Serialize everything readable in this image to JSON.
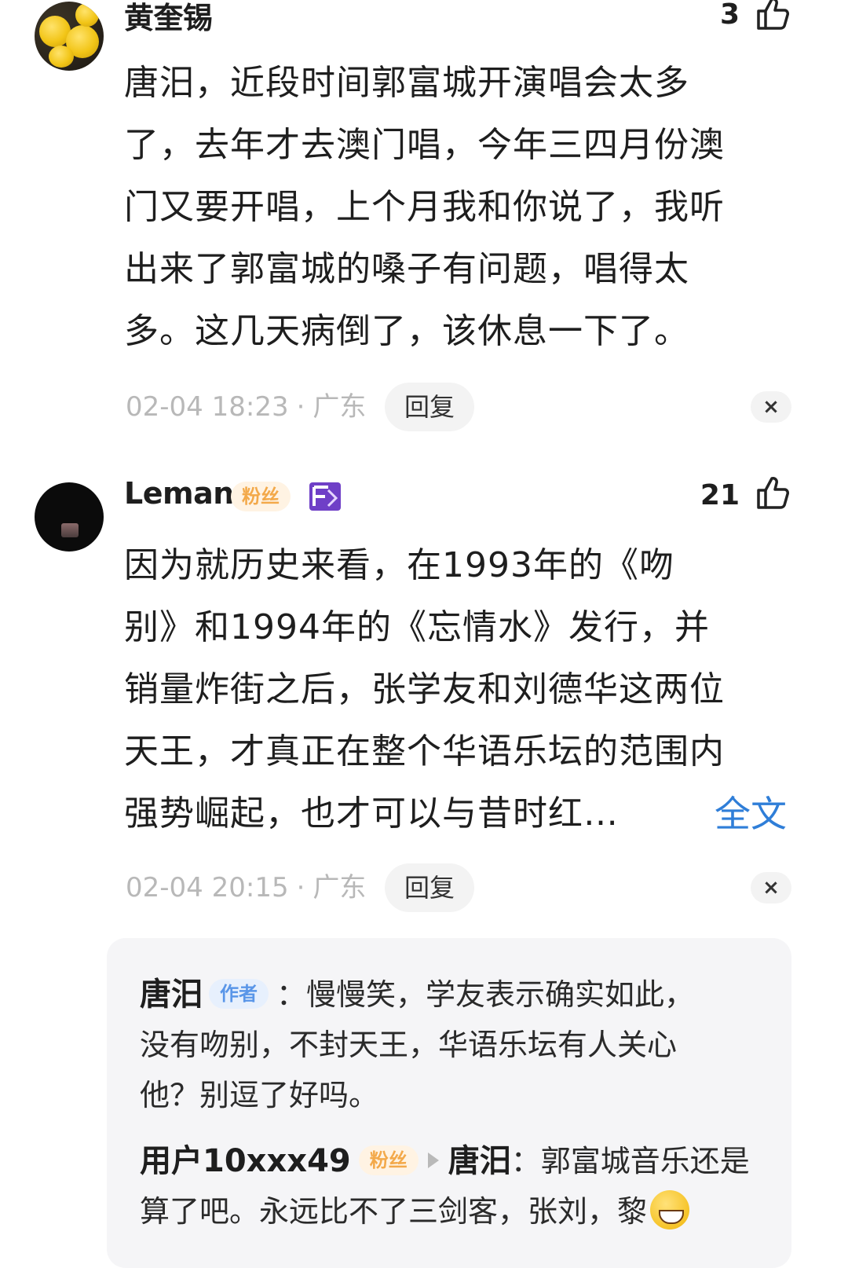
{
  "comments": [
    {
      "username": "黄奎锡",
      "like_count": "3",
      "lines": [
        "唐汨，近段时间郭富城开演唱会太多",
        "了，去年才去澳门唱，今年三四月份澳",
        "门又要开唱，上个月我和你说了，我听",
        "出来了郭富城的嗓子有问题，唱得太",
        "多。这几天病倒了，该休息一下了。"
      ],
      "timestamp": "02-04 18:23",
      "location": "广东",
      "reply_label": "回复",
      "close_label": "×"
    },
    {
      "username": "Leman",
      "fan_badge": "粉丝",
      "like_count": "21",
      "lines": [
        "因为就历史来看，在1993年的《吻",
        "别》和1994年的《忘情水》发行，并",
        "销量炸街之后，张学友和刘德华这两位",
        "天王，才真正在整个华语乐坛的范围内",
        "强势崛起，也才可以与昔时红…"
      ],
      "full_text_label": "全文",
      "timestamp": "02-04 20:15",
      "location": "广东",
      "reply_label": "回复",
      "close_label": "×"
    }
  ],
  "replies": [
    {
      "author": "唐汨",
      "author_badge": "作者",
      "separator": "：",
      "lines": [
        "慢慢笑，学友表示确实如此，",
        "没有吻别，不封天王，华语乐坛有人关心",
        "他？别逗了好吗。"
      ]
    },
    {
      "author": "用户10xxx49",
      "author_badge": "粉丝",
      "reply_to": "唐汨",
      "separator": "：",
      "lines": [
        "郭富城音乐还是",
        "算了吧。永远比不了三剑客，张刘，黎"
      ],
      "emoji": "grinning-face"
    }
  ],
  "colors": {
    "link": "#2f7ed8",
    "fan_badge_text": "#f3a94a",
    "author_badge_text": "#5a96e8",
    "meta_text": "#b8b8b8"
  }
}
